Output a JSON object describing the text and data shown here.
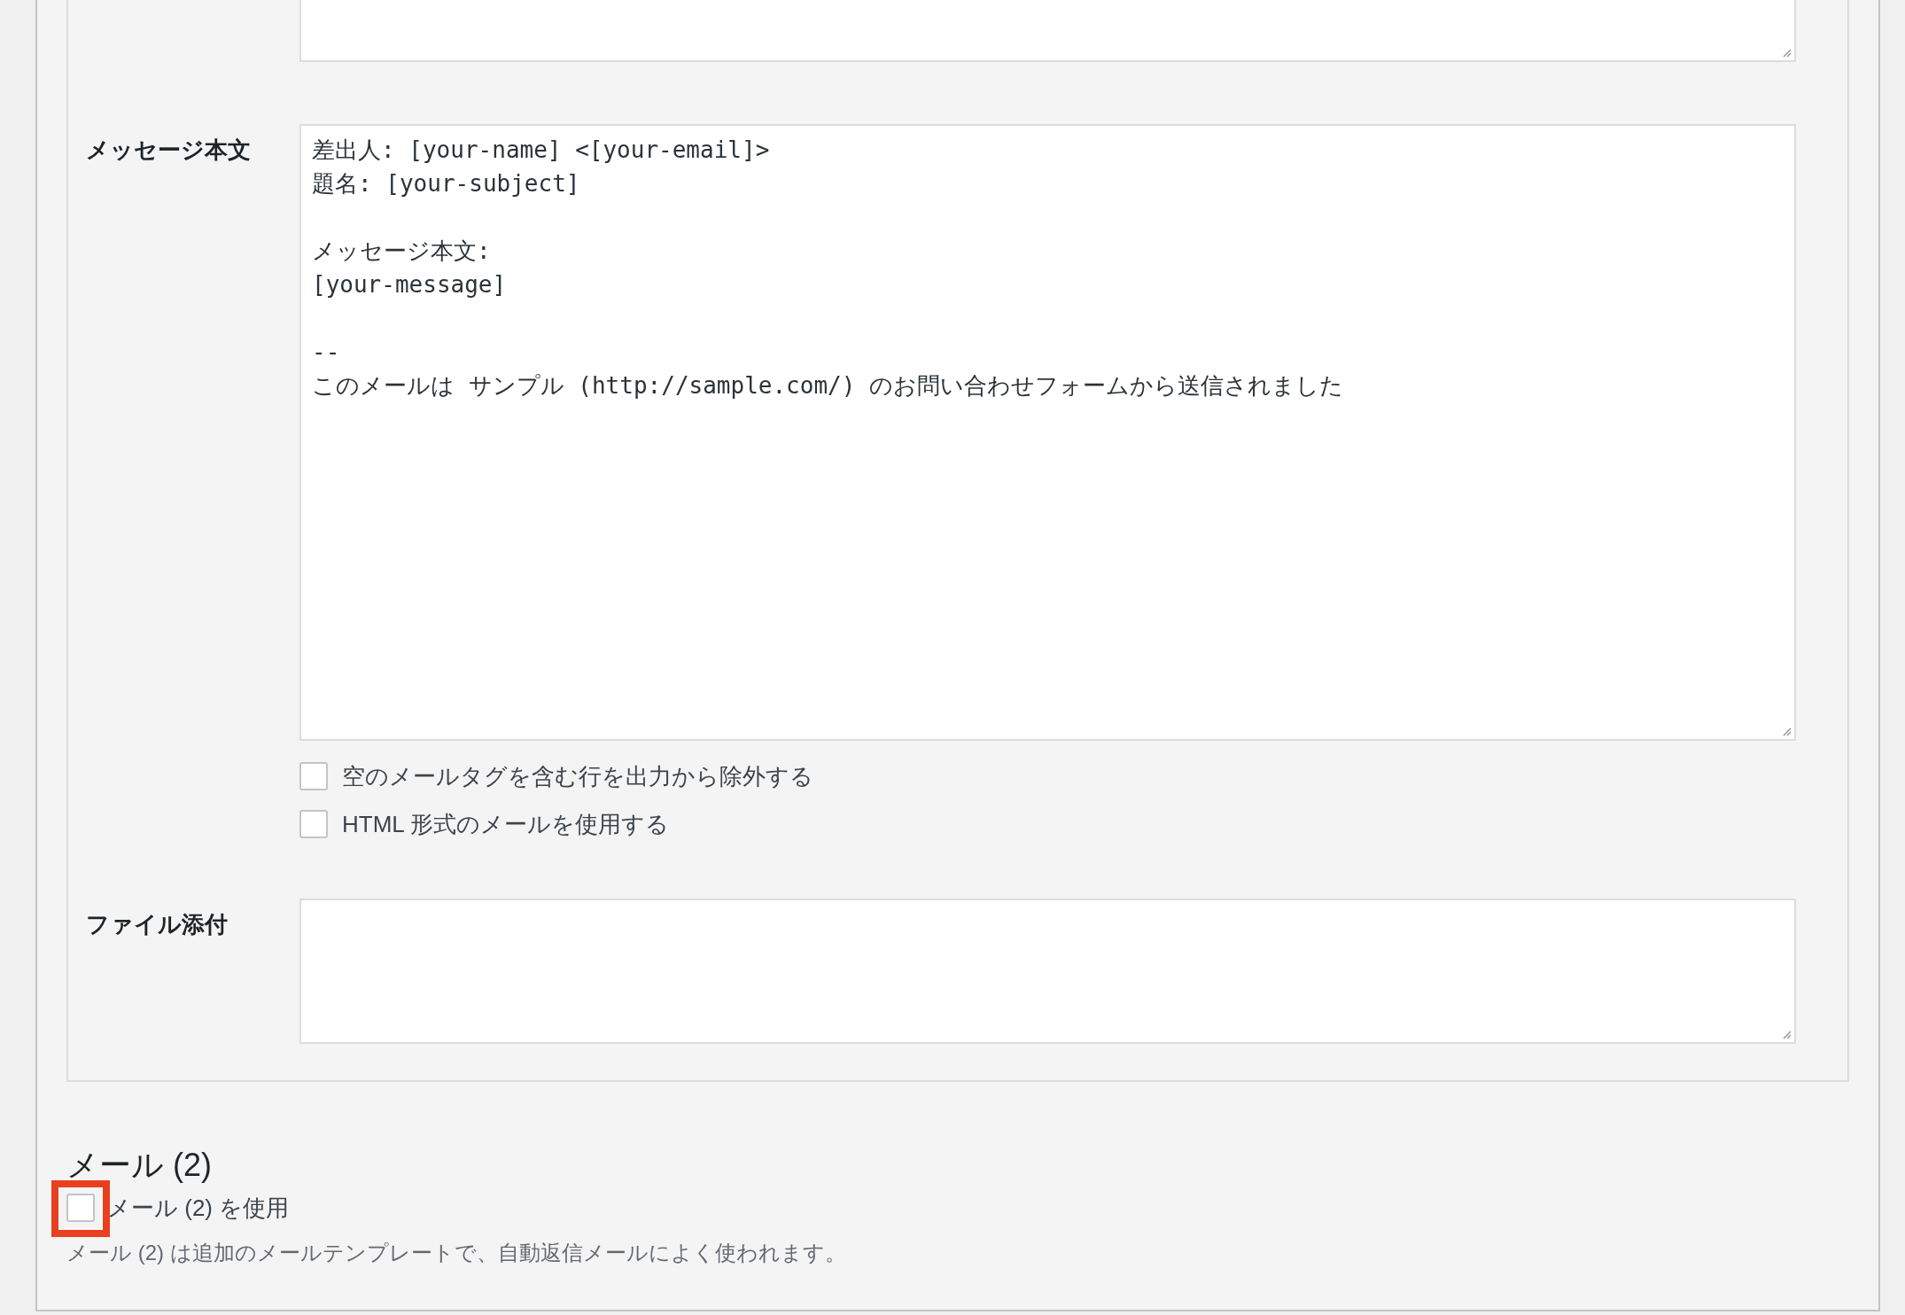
{
  "mail_form": {
    "message_body": {
      "label": "メッセージ本文",
      "value": "差出人: [your-name] <[your-email]>\n題名: [your-subject]\n\nメッセージ本文:\n[your-message]\n\n--\nこのメールは サンプル (http://sample.com/) のお問い合わせフォームから送信されました"
    },
    "options": [
      {
        "label": "空のメールタグを含む行を出力から除外する",
        "checked": false
      },
      {
        "label": "HTML 形式のメールを使用する",
        "checked": false
      }
    ],
    "attachments": {
      "label": "ファイル添付"
    }
  },
  "mail_2": {
    "heading": "メール (2)",
    "use_checkbox": {
      "label": "メール (2) を使用",
      "checked": false,
      "highlighted": true
    },
    "description": "メール (2) は追加のメールテンプレートで、自動返信メールによく使われます。"
  }
}
